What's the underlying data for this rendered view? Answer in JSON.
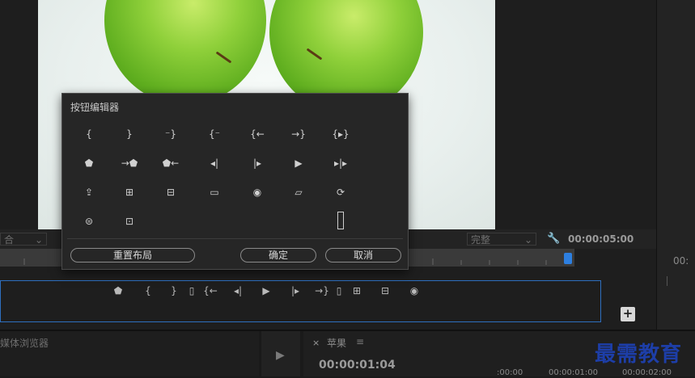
{
  "monitor": {
    "fit_dropdown": "合",
    "quality_dropdown": "完整",
    "timecode": "00:00:05:00",
    "right_timecode": "00:"
  },
  "dialog": {
    "title": "按钮编辑器",
    "reset_label": "重置布局",
    "ok_label": "确定",
    "cancel_label": "取消",
    "rows": [
      [
        "{",
        "}",
        "⁻}",
        "{⁻",
        "{←",
        "→}",
        "{▸}"
      ],
      [
        "⬟",
        "→⬟",
        "⬟←",
        "◂|",
        "|▸",
        "▶",
        "▸|▸"
      ],
      [
        "⇪",
        "⊞",
        "⊟",
        "▭",
        "◉",
        "▱",
        "⟳"
      ],
      [
        "⊜",
        "⊡"
      ]
    ]
  },
  "buttonbar": {
    "icons": [
      "⬟",
      "{",
      "}",
      "▯",
      "{←",
      "◂|",
      "▶",
      "|▸",
      "→}",
      "▯",
      "⊞",
      "⊟",
      "◉"
    ],
    "add_label": "+"
  },
  "lower": {
    "media_browser": "媒体浏览器",
    "tab_close": "×",
    "sequence_name": "苹果",
    "menu": "≡",
    "timecode": "00:00:01:04",
    "ticks": [
      ":00:00",
      "00:00:01:00",
      "00:00:02:00"
    ],
    "watermark": "最需教育"
  }
}
